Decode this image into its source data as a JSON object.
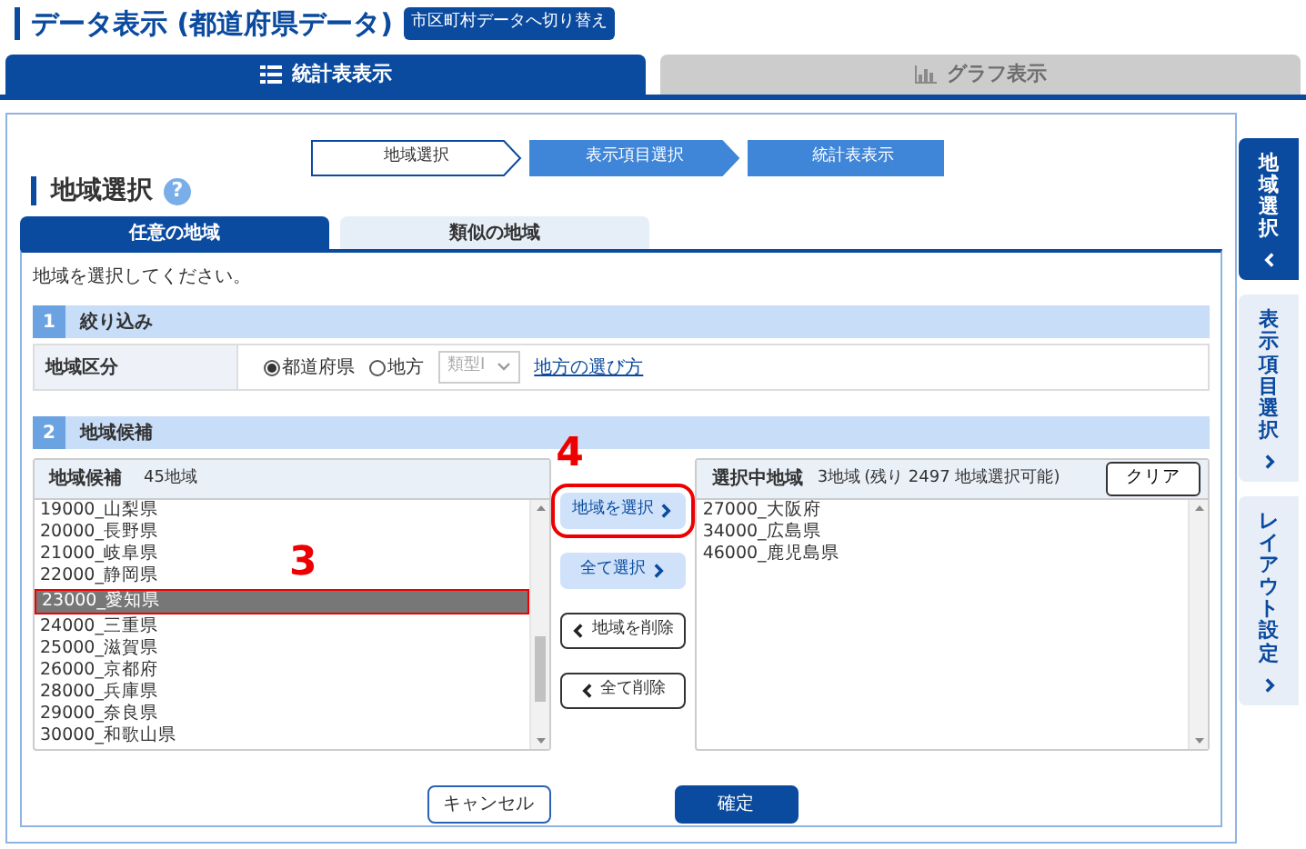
{
  "header": {
    "title": "データ表示 (都道府県データ)",
    "switch_button": "市区町村データへ切り替え"
  },
  "main_tabs": [
    {
      "label": "統計表表示",
      "selected": true
    },
    {
      "label": "グラフ表示",
      "selected": false
    }
  ],
  "steps": [
    {
      "label": "地域選択",
      "current": true
    },
    {
      "label": "表示項目選択",
      "current": false
    },
    {
      "label": "統計表表示",
      "current": false
    }
  ],
  "heading": {
    "title": "地域選択",
    "help": "?"
  },
  "sub_tabs": [
    {
      "label": "任意の地域",
      "selected": true
    },
    {
      "label": "類似の地域",
      "selected": false
    }
  ],
  "instruction": "地域を選択してください。",
  "sections": [
    {
      "number": "1",
      "title": "絞り込み"
    },
    {
      "number": "2",
      "title": "地域候補"
    }
  ],
  "filter": {
    "label": "地域区分",
    "options": [
      {
        "label": "都道府県",
        "selected": true
      },
      {
        "label": "地方",
        "selected": false
      }
    ],
    "type_select": {
      "value": "類型Ⅰ",
      "disabled": true
    },
    "link": "地方の選び方"
  },
  "candidates": {
    "title": "地域候補",
    "count": "45地域",
    "items": [
      {
        "label": "19000_山梨県",
        "selected": false
      },
      {
        "label": "20000_長野県",
        "selected": false
      },
      {
        "label": "21000_岐阜県",
        "selected": false
      },
      {
        "label": "22000_静岡県",
        "selected": false
      },
      {
        "label": "23000_愛知県",
        "selected": true,
        "annotation": "3"
      },
      {
        "label": "24000_三重県",
        "selected": false
      },
      {
        "label": "25000_滋賀県",
        "selected": false
      },
      {
        "label": "26000_京都府",
        "selected": false
      },
      {
        "label": "28000_兵庫県",
        "selected": false
      },
      {
        "label": "29000_奈良県",
        "selected": false
      },
      {
        "label": "30000_和歌山県",
        "selected": false
      }
    ]
  },
  "transfer_buttons": [
    {
      "label": "地域を選択",
      "kind": "add",
      "annotation": "4"
    },
    {
      "label": "全て選択",
      "kind": "add"
    },
    {
      "label": "地域を削除",
      "kind": "remove"
    },
    {
      "label": "全て削除",
      "kind": "remove"
    }
  ],
  "selected_regions": {
    "title": "選択中地域",
    "count": "3地域",
    "remaining": "(残り 2497 地域選択可能)",
    "clear_button": "クリア",
    "items": [
      "27000_大阪府",
      "34000_広島県",
      "46000_鹿児島県"
    ]
  },
  "footer_buttons": [
    {
      "label": "キャンセル",
      "kind": "outline"
    },
    {
      "label": "確定",
      "kind": "primary"
    }
  ],
  "side_tabs": [
    {
      "label": "地域選択",
      "selected": true
    },
    {
      "label": "表示項目選択",
      "selected": false
    },
    {
      "label": "レイアウト設定",
      "selected": false
    }
  ]
}
